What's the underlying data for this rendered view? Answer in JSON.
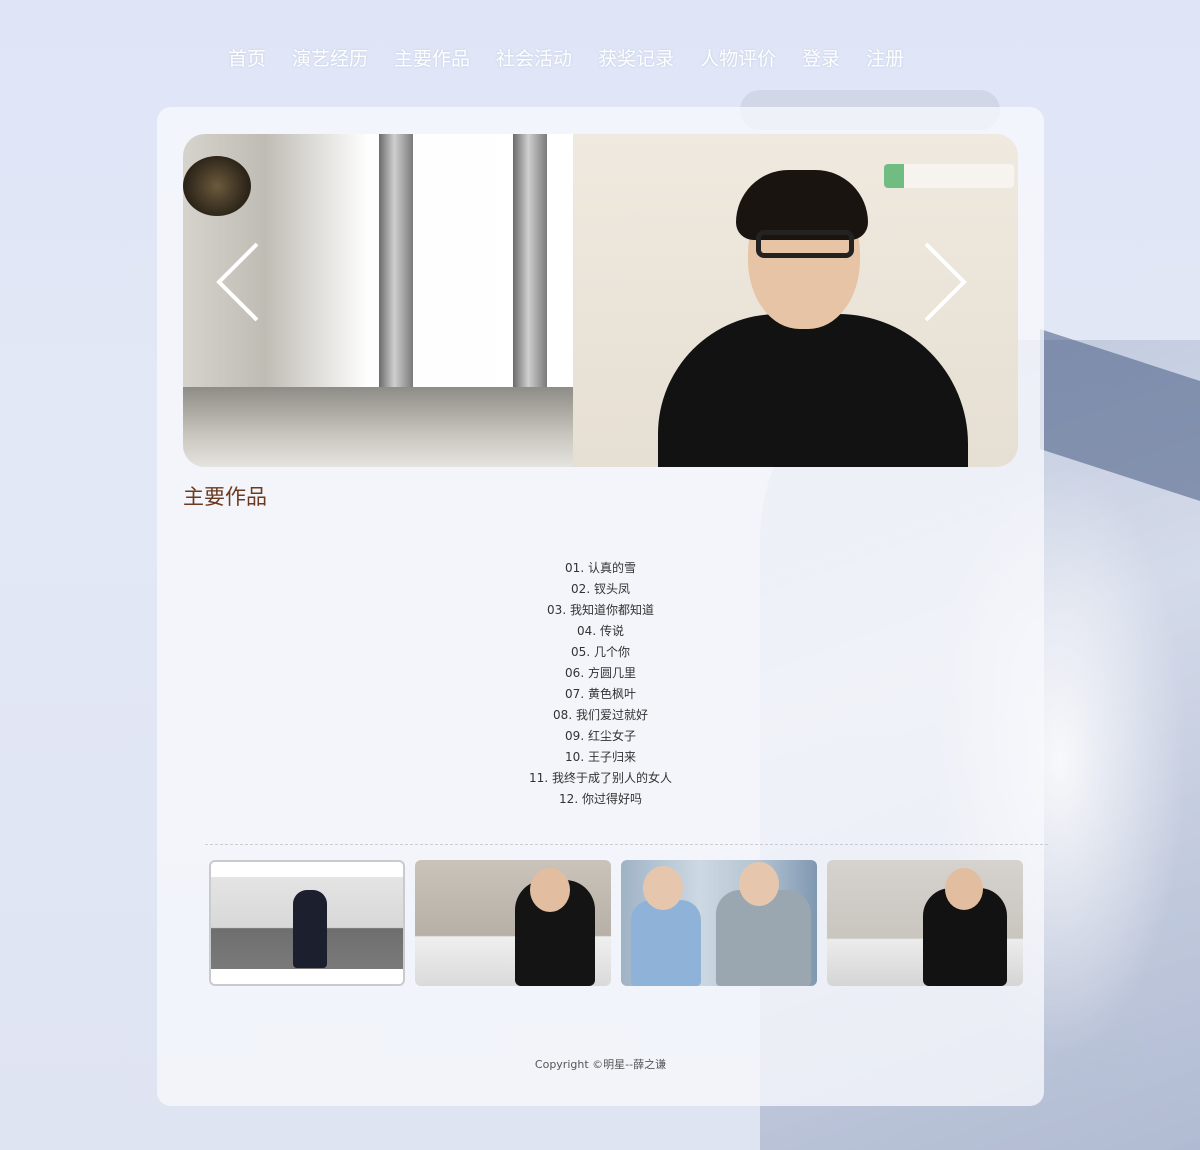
{
  "nav": {
    "items": [
      "首页",
      "演艺经历",
      "主要作品",
      "社会活动",
      "获奖记录",
      "人物评价",
      "登录",
      "注册"
    ]
  },
  "section": {
    "title": "主要作品"
  },
  "works": [
    "01. 认真的雪",
    "02. 钗头凤",
    "03. 我知道你都知道",
    "04. 传说",
    "05. 几个你",
    "06. 方圆几里",
    "07. 黄色枫叶",
    "08. 我们爱过就好",
    "09. 红尘女子",
    "10. 王子归来",
    "11. 我终于成了别人的女人",
    "12. 你过得好吗"
  ],
  "footer": {
    "copyright": "Copyright ©明星--薛之谦"
  },
  "icons": {
    "prev": "chevron-left-icon",
    "next": "chevron-right-icon"
  },
  "colors": {
    "title": "#6b3a1f",
    "nav_text": "#ffffff",
    "panel": "#f7f8fd"
  }
}
